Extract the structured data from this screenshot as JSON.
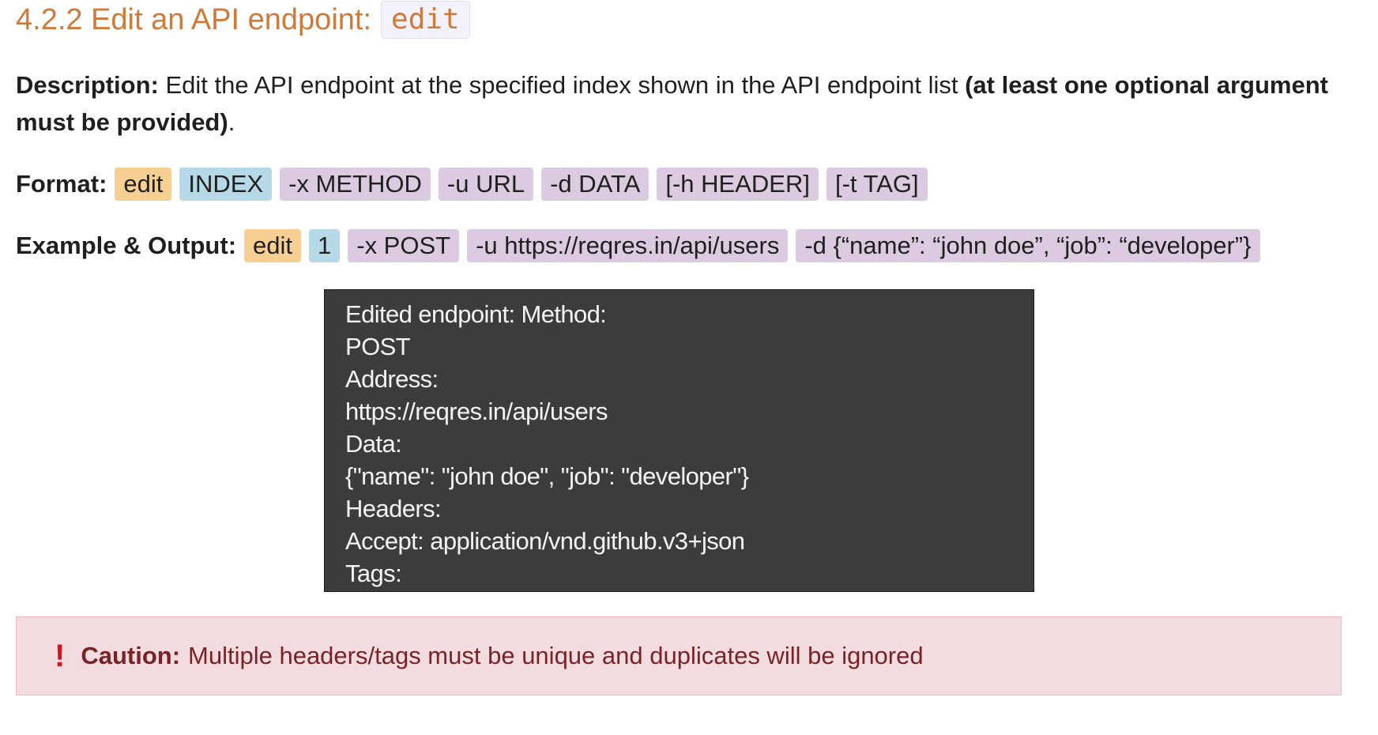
{
  "heading": {
    "title": "4.2.2 Edit an API endpoint:",
    "command": "edit"
  },
  "description": {
    "label": "Description:",
    "text": " Edit the API endpoint at the specified index shown in the API endpoint list ",
    "emphasis": "(at least one optional argument must be provided)",
    "end": "."
  },
  "format": {
    "label": "Format:",
    "tokens": [
      "edit",
      "INDEX",
      "-x METHOD",
      "-u URL",
      "-d DATA",
      "[-h HEADER]",
      "[-t TAG]"
    ]
  },
  "example": {
    "label": "Example & Output:",
    "tokens": [
      "edit",
      "1",
      "-x POST",
      "-u https://reqres.in/api/users",
      "-d {“name”: “john doe”, “job”: “developer”}"
    ]
  },
  "terminal": {
    "lines": [
      "Edited endpoint: Method:",
      "POST",
      "Address:",
      "https://reqres.in/api/users",
      "Data:",
      "{\"name\": \"john doe\", \"job\": \"developer\"}",
      "Headers:",
      "Accept: application/vnd.github.v3+json",
      "Tags:"
    ]
  },
  "caution": {
    "icon": "!",
    "label": "Caution:",
    "text": "Multiple headers/tags must be unique and duplicates will be ignored"
  },
  "colors": {
    "heading": "#cf7a3a",
    "command_tag": "#f7cf92",
    "index_tag": "#b5d9e6",
    "option_tag": "#dccbe0",
    "terminal_bg": "#3c3c3c",
    "caution_bg": "#f3dcdf",
    "caution_text": "#7a2226",
    "caution_icon": "#d7141f"
  }
}
